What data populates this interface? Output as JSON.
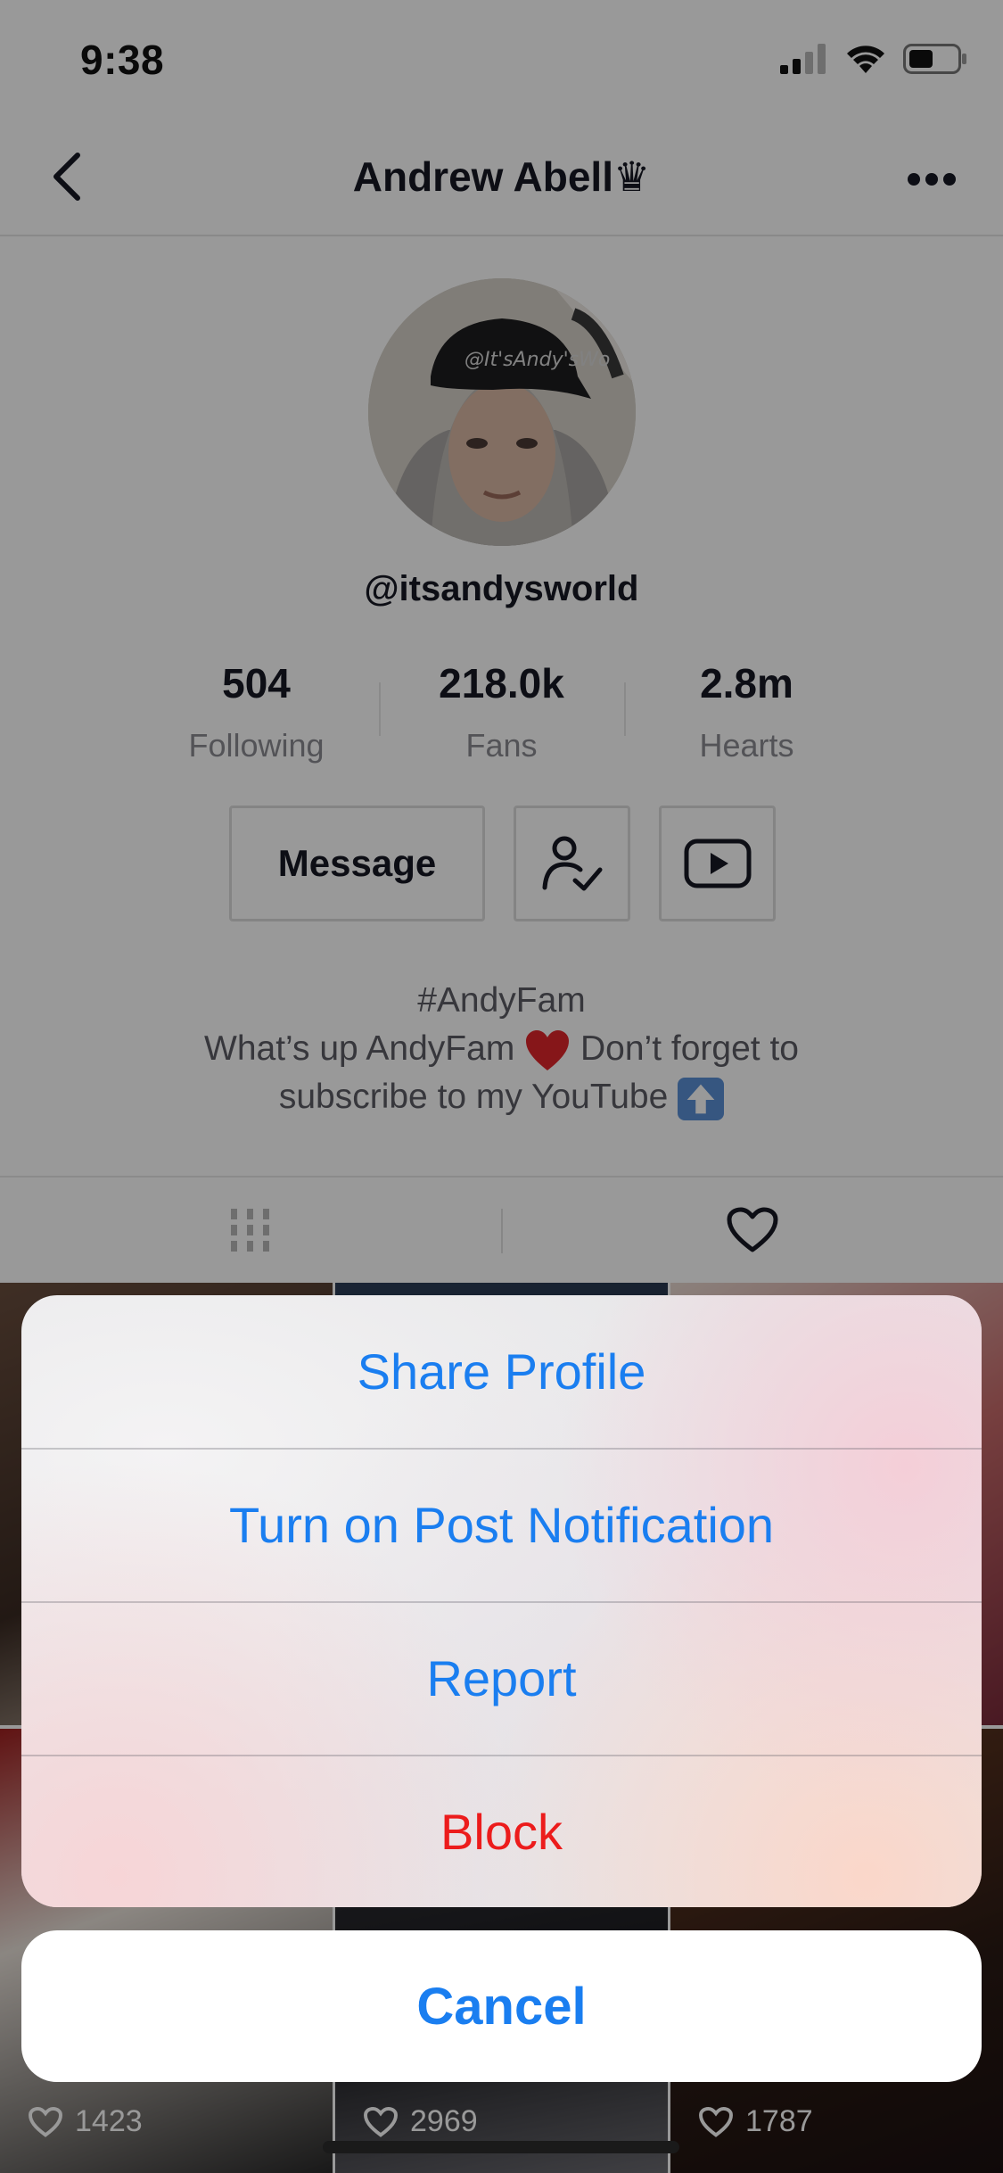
{
  "status_bar": {
    "time": "9:38"
  },
  "nav": {
    "title": "Andrew Abell♛"
  },
  "profile": {
    "username": "@itsandysworld",
    "avatar_hat_text": "@It'sAndy'sWo",
    "stats": [
      {
        "value": "504",
        "label": "Following"
      },
      {
        "value": "218.0k",
        "label": "Fans"
      },
      {
        "value": "2.8m",
        "label": "Hearts"
      }
    ],
    "message_label": "Message",
    "bio_line1": "#AndyFam",
    "bio_line2_a": "What’s up AndyFam",
    "bio_line2_b": "Don’t forget to",
    "bio_line3": "subscribe to my YouTube"
  },
  "grid": {
    "likes": [
      "1423",
      "2969",
      "1787"
    ]
  },
  "action_sheet": {
    "items": [
      "Share Profile",
      "Turn on Post Notification",
      "Report",
      "Block"
    ],
    "cancel": "Cancel"
  },
  "colors": {
    "ios_blue": "#1a7ef0",
    "destructive_red": "#ec1c1c",
    "text_primary": "#161823"
  }
}
